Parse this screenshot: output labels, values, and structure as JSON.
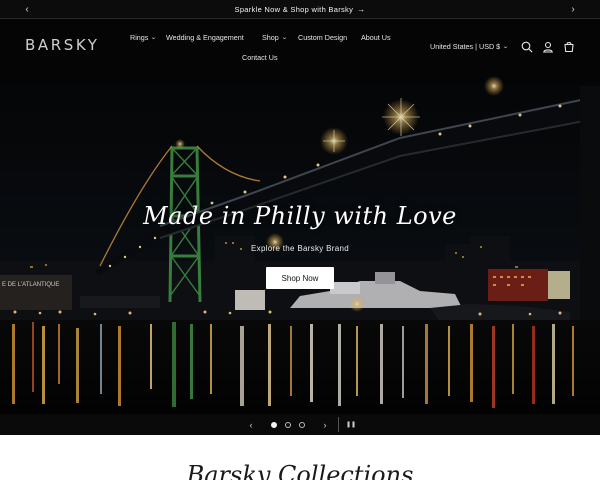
{
  "announcement": {
    "prev_label": "‹",
    "text": "Sparkle Now & Shop with Barsky",
    "arrow": "→",
    "next_label": "›"
  },
  "header": {
    "logo": "BARSKY",
    "nav": [
      {
        "label": "Rings",
        "chevron": "⌄"
      },
      {
        "label": "Wedding & Engagement",
        "chevron": ""
      },
      {
        "label": "Shop",
        "chevron": "⌄"
      },
      {
        "label": "Custom Design",
        "chevron": ""
      },
      {
        "label": "About Us",
        "chevron": ""
      },
      {
        "label": "Contact Us",
        "chevron": ""
      }
    ],
    "locale": {
      "label": "United States | USD $",
      "chevron": "⌄"
    },
    "icons": [
      "search-icon",
      "account-icon",
      "cart-icon"
    ]
  },
  "hero": {
    "title": "Made in Philly with Love",
    "subtitle": "Explore the Barsky Brand",
    "button": "Shop Now",
    "sign_text": "E DE L'ATLANTIQUE"
  },
  "slider": {
    "prev": "‹",
    "next": "›",
    "pause": "❚❚",
    "slide_count": 3,
    "active_slide": 1
  },
  "section": {
    "title": "Barsky Collections"
  },
  "colors": {
    "background": "#050505",
    "bridge_green": "#3f8f45",
    "button_bg": "#ffffff",
    "text_light": "#f2f2f2"
  }
}
